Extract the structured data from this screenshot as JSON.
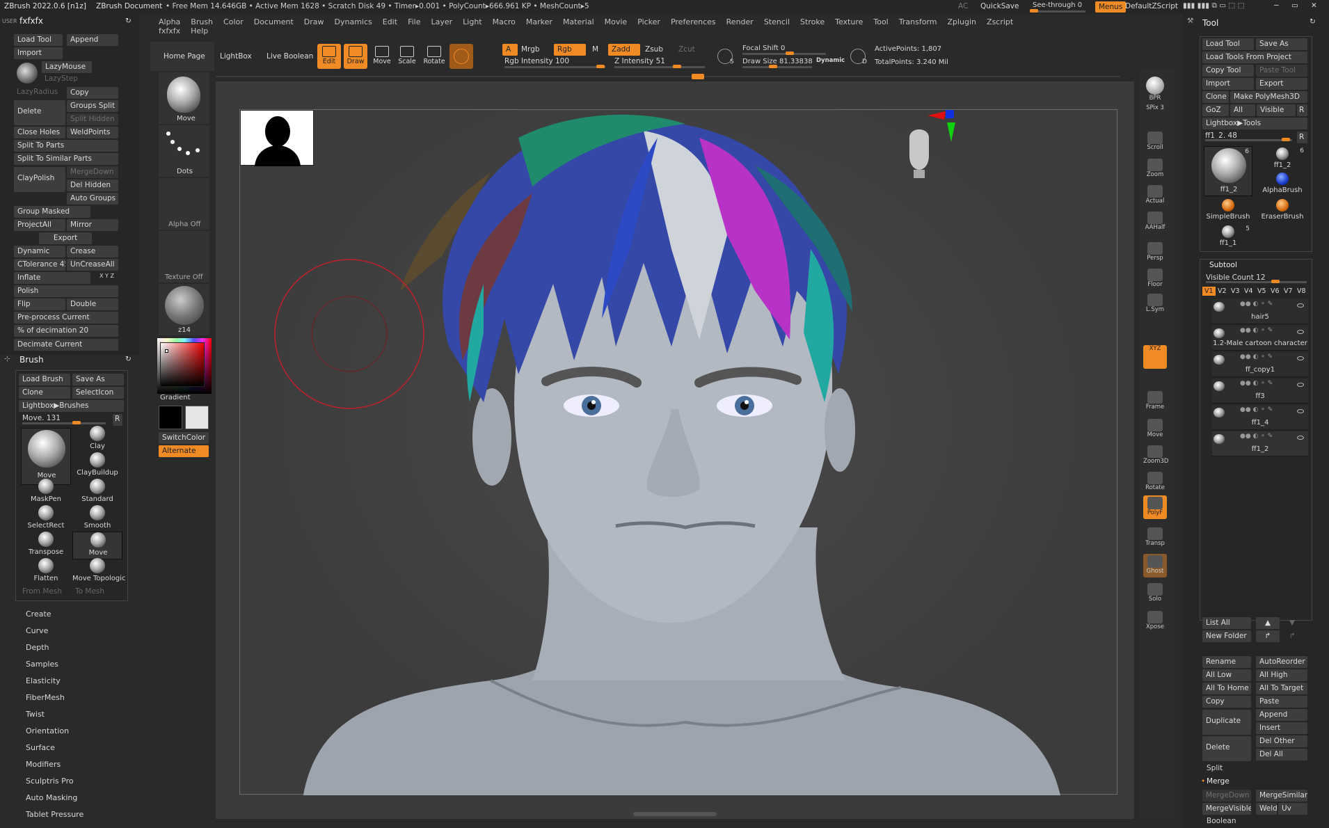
{
  "app": {
    "title": "ZBrush 2022.0.6 [n1z]",
    "doc": "ZBrush Document",
    "status": "• Free Mem 14.646GB • Active Mem 1628 • Scratch Disk 49 • Timer▸0.001 • PolyCount▸666.961 KP • MeshCount▸5",
    "ac": "AC",
    "quicksave": "QuickSave",
    "seethrough": "See-through  0",
    "menus": "Menus",
    "zscript": "DefaultZScript"
  },
  "menubar": [
    "Alpha",
    "Brush",
    "Color",
    "Document",
    "Draw",
    "Dynamics",
    "Edit",
    "File",
    "Layer",
    "Light",
    "Macro",
    "Marker",
    "Material",
    "Movie",
    "Picker",
    "Preferences",
    "Render",
    "Stencil",
    "Stroke",
    "Texture",
    "Tool",
    "Transform",
    "Zplugin",
    "Zscript",
    "fxfxfx",
    "Help"
  ],
  "left_top": {
    "user": "USER",
    "title": "fxfxfx",
    "load_tool": "Load Tool",
    "append": "Append",
    "import": "Import",
    "lazymouse": "LazyMouse",
    "lazystep": "LazyStep",
    "lazyradius": "LazyRadius",
    "copy": "Copy",
    "delete": "Delete",
    "groups_split": "Groups Split",
    "split_hidden": "Split Hidden",
    "close_holes": "Close Holes",
    "weldpoints": "WeldPoints",
    "split_to_parts": "Split To Parts",
    "split_similar": "Split To Similar Parts",
    "claypolish": "ClayPolish",
    "mergedown": "MergeDown",
    "del_hidden": "Del Hidden",
    "auto_groups": "Auto Groups",
    "group_masked": "Group Masked",
    "projectall": "ProjectAll",
    "mirror": "Mirror",
    "export": "Export",
    "dynamic": "Dynamic",
    "crease": "Crease",
    "ctolerance": "CTolerance 45",
    "uncreaseall": "UnCreaseAll",
    "inflate": "Inflate",
    "xyz": "X Y Z",
    "polish": "Polish",
    "flip": "Flip",
    "double": "Double",
    "preprocess": "Pre-process Current",
    "decimation": "% of decimation 20",
    "decimate": "Decimate Current"
  },
  "brush_panel": {
    "title": "Brush",
    "load_brush": "Load Brush",
    "save_as": "Save As",
    "clone": "Clone",
    "selecticon": "SelectIcon",
    "lightbox": "Lightbox▶Brushes",
    "move_val": "Move. 131",
    "r": "R",
    "brushes": [
      "Move",
      "Clay",
      "ClayBuildup",
      "MaskPen",
      "Standard",
      "SelectRect",
      "Smooth",
      "Transpose",
      "Move",
      "Flatten",
      "Move Topologic"
    ],
    "from_mesh": "From Mesh",
    "to_mesh": "To Mesh"
  },
  "left_sections": [
    "Create",
    "Curve",
    "Depth",
    "Samples",
    "Elasticity",
    "FiberMesh",
    "Twist",
    "Orientation",
    "Surface",
    "Modifiers",
    "Sculptris Pro",
    "Auto Masking",
    "Tablet Pressure"
  ],
  "shelf": {
    "move": "Move",
    "dots": "Dots",
    "alpha_off": "Alpha Off",
    "texture_off": "Texture Off",
    "material": "z14",
    "gradient": "Gradient",
    "switchcolor": "SwitchColor",
    "alternate": "Alternate"
  },
  "toolbar": {
    "home": "Home Page",
    "lightbox": "LightBox",
    "live_boolean": "Live Boolean",
    "edit": "Edit",
    "draw": "Draw",
    "move": "Move",
    "scale": "Scale",
    "rotate": "Rotate",
    "a": "A",
    "mrgb": "Mrgb",
    "rgb": "Rgb",
    "m": "M",
    "zadd": "Zadd",
    "zsub": "Zsub",
    "zcut": "Zcut",
    "rgb_intensity": "Rgb Intensity 100",
    "z_intensity": "Z Intensity 51",
    "focal_shift": "Focal Shift 0",
    "draw_size": "Draw Size 81.33838",
    "dynamic": "Dynamic",
    "active_points": "ActivePoints: 1,807",
    "total_points": "TotalPoints: 3.240 Mil"
  },
  "right_tools": [
    "BPR",
    "SPix 3",
    "Scroll",
    "Zoom",
    "Actual",
    "AAHalf",
    "Persp",
    "Floor",
    "L.Sym",
    "",
    "XYZ",
    "",
    "",
    "Frame",
    "Move",
    "Zoom3D",
    "Rotate",
    "PolyF",
    "Transp",
    "Ghost",
    "Solo",
    "Xpose"
  ],
  "tool_panel": {
    "title": "Tool",
    "load_tool": "Load Tool",
    "save_as": "Save As",
    "load_from_project": "Load Tools From Project",
    "copy_tool": "Copy Tool",
    "paste_tool": "Paste Tool",
    "import": "Import",
    "export": "Export",
    "clone": "Clone",
    "make_polymesh": "Make PolyMesh3D",
    "goz": "GoZ",
    "all": "All",
    "visible": "Visible",
    "r": "R",
    "lightbox_tools": "Lightbox▶Tools",
    "current": "ff1_2. 48",
    "thumbs": [
      {
        "name": "ff1_2",
        "n": "6"
      },
      {
        "name": "ff1_2",
        "n": "6"
      },
      {
        "name": "AlphaBrush",
        "n": ""
      },
      {
        "name": "SimpleBrush",
        "n": ""
      },
      {
        "name": "EraserBrush",
        "n": ""
      },
      {
        "name": "ff1_1",
        "n": "5"
      }
    ],
    "subtool": "Subtool",
    "visible_count": "Visible Count 12",
    "vtabs": [
      "V1",
      "V2",
      "V3",
      "V4",
      "V5",
      "V6",
      "V7",
      "V8"
    ],
    "subtools": [
      "hair5",
      "1.2-Male cartoon character",
      "ff_copy1",
      "ff3",
      "ff1_4",
      "ff1_2"
    ],
    "list_all": "List All",
    "new_folder": "New Folder",
    "rename": "Rename",
    "autoreorder": "AutoReorder",
    "all_low": "All Low",
    "all_high": "All High",
    "all_to_home": "All To Home",
    "all_to_target": "All To Target",
    "copy": "Copy",
    "paste": "Paste",
    "duplicate": "Duplicate",
    "append": "Append",
    "insert": "Insert",
    "delete": "Delete",
    "del_other": "Del Other",
    "del_all": "Del All",
    "split": "Split",
    "merge": "Merge",
    "mergedown": "MergeDown",
    "mergesimilar": "MergeSimilar",
    "mergevisible": "MergeVisible",
    "weld": "Weld",
    "uv": "Uv",
    "boolean": "Boolean"
  },
  "colors": {
    "accent": "#f08a24",
    "bg": "#2a2a2a",
    "canvas": "#444444",
    "panel": "#2b2b2b"
  }
}
